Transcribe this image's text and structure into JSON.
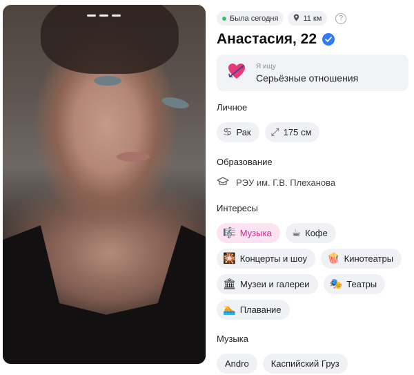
{
  "photo": {
    "indicator_count": 3
  },
  "status": {
    "last_seen": "Была сегодня",
    "distance": "11 км",
    "help": "?"
  },
  "profile": {
    "name_age": "Анастасия, 22"
  },
  "looking_for": {
    "label": "Я ищу",
    "value": "Серьёзные отношения",
    "icon": "heart-with-arrow-icon"
  },
  "personal": {
    "title": "Личное",
    "items": [
      {
        "label": "Рак",
        "icon": "zodiac-cancer-icon",
        "glyph": "♋"
      },
      {
        "label": "175 см",
        "icon": "height-arrows-icon",
        "glyph": "⤢"
      }
    ]
  },
  "education": {
    "title": "Образование",
    "value": "РЭУ им. Г.В. Плеханова",
    "icon": "graduation-cap-icon"
  },
  "interests": {
    "title": "Интересы",
    "items": [
      {
        "label": "Музыка",
        "emoji": "🎼",
        "active": true
      },
      {
        "label": "Кофе",
        "emoji": "☕",
        "active": false
      },
      {
        "label": "Концерты и шоу",
        "emoji": "🎇",
        "active": false
      },
      {
        "label": "Кинотеатры",
        "emoji": "🍿",
        "active": false
      },
      {
        "label": "Музеи и галереи",
        "emoji": "🏛",
        "active": false
      },
      {
        "label": "Театры",
        "emoji": "🎭",
        "active": false
      },
      {
        "label": "Плавание",
        "emoji": "🏊",
        "active": false
      }
    ]
  },
  "music": {
    "title": "Музыка",
    "items": [
      {
        "label": "Andro"
      },
      {
        "label": "Каспийский Груз"
      }
    ]
  },
  "colors": {
    "accent_pink": "#d9258e",
    "verified_blue": "#2f7cf6",
    "online_green": "#34c26b"
  }
}
